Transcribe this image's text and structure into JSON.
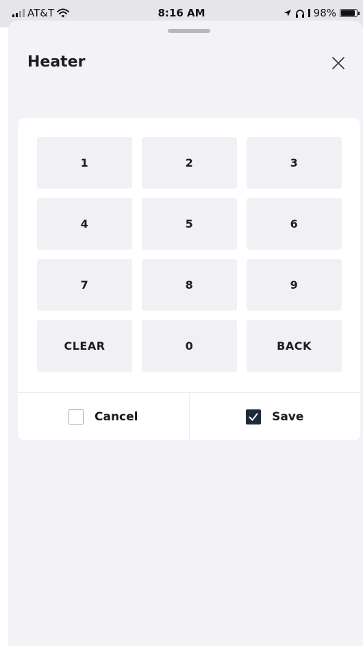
{
  "status_bar": {
    "carrier": "AT&T",
    "time": "8:16 AM",
    "battery": "98%",
    "battery_level": 0.98,
    "signal_icon": "signal-bars-icon",
    "wifi_icon": "wifi-icon",
    "location_icon": "location-arrow-icon",
    "headphones_icon": "headphones-icon",
    "battery_icon": "battery-icon"
  },
  "sheet": {
    "title": "Heater",
    "close_icon": "close-icon"
  },
  "keypad": {
    "keys": [
      {
        "id": "1",
        "label": "1"
      },
      {
        "id": "2",
        "label": "2"
      },
      {
        "id": "3",
        "label": "3"
      },
      {
        "id": "4",
        "label": "4"
      },
      {
        "id": "5",
        "label": "5"
      },
      {
        "id": "6",
        "label": "6"
      },
      {
        "id": "7",
        "label": "7"
      },
      {
        "id": "8",
        "label": "8"
      },
      {
        "id": "9",
        "label": "9"
      },
      {
        "id": "clear",
        "label": "CLEAR"
      },
      {
        "id": "0",
        "label": "0"
      },
      {
        "id": "back",
        "label": "BACK"
      }
    ]
  },
  "actions": {
    "cancel": {
      "label": "Cancel",
      "checked": false
    },
    "save": {
      "label": "Save",
      "checked": true
    }
  },
  "colors": {
    "sheet_background": "#f2f2f7",
    "key_background": "#f1f1f5",
    "checked_box": "#1e2a3a"
  }
}
